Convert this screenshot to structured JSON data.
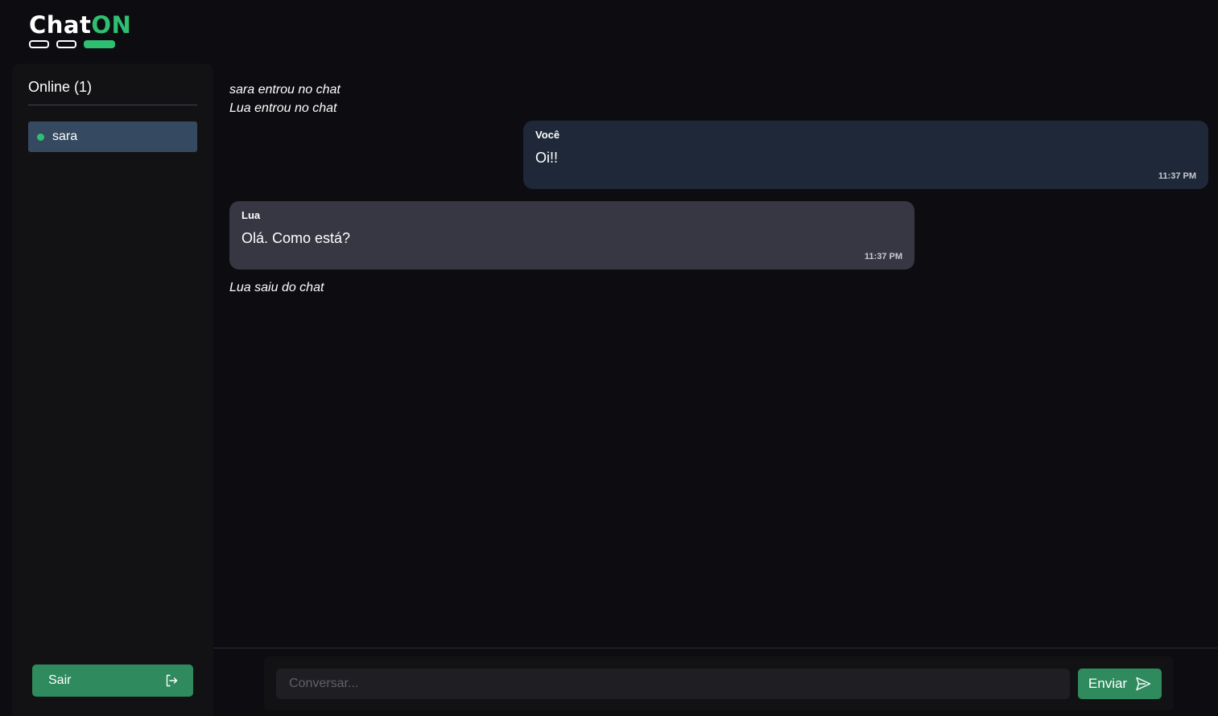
{
  "app": {
    "logo": {
      "part1": "Chat",
      "part2": "ON"
    }
  },
  "sidebar": {
    "online_title": "Online (1)",
    "users": [
      {
        "name": "sara",
        "status_color": "#2fbf71"
      }
    ],
    "logout_label": "Sair",
    "logout_icon": "logout-icon"
  },
  "messages": {
    "system_top": [
      "sara entrou no chat",
      "Lua entrou no chat"
    ],
    "chat": [
      {
        "sender": "Você",
        "text": "Oi!!",
        "time": "11:37 PM",
        "own": true
      },
      {
        "sender": "Lua",
        "text": "Olá. Como está?",
        "time": "11:37 PM",
        "own": false
      }
    ],
    "system_bottom": "Lua saiu do chat"
  },
  "composer": {
    "placeholder": "Conversar...",
    "value": "",
    "send_label": "Enviar",
    "send_icon": "send-icon"
  },
  "colors": {
    "accent": "#2fbf71",
    "button": "#2f8a5e",
    "background": "#0d0d11",
    "sidebar": "#121214",
    "own_bubble": "#1f2838",
    "other_bubble": "#373743",
    "active_user": "#354a60"
  }
}
